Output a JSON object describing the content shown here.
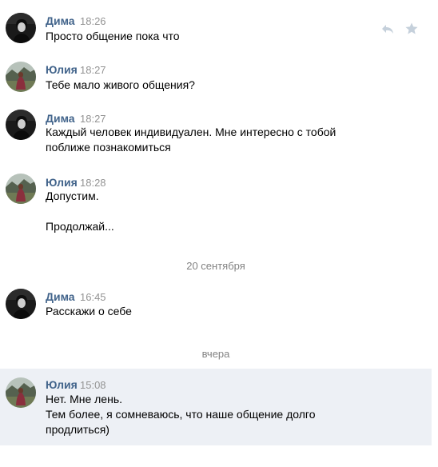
{
  "messages": [
    {
      "author": "Дима",
      "time": "18:26",
      "text": "Просто общение пока что"
    },
    {
      "author": "Юлия",
      "time": "18:27",
      "text": "Тебе мало живого общения?"
    },
    {
      "author": "Дима",
      "time": "18:27",
      "text": "Каждый человек индивидуален. Мне интересно с тобой\nпоближе познакомиться"
    },
    {
      "author": "Юлия",
      "time": "18:28",
      "text": "Допустим.\n\nПродолжай..."
    },
    {
      "author": "Дима",
      "time": "16:45",
      "text": "Расскажи о себе"
    },
    {
      "author": "Юлия",
      "time": "15:08",
      "text": "Нет. Мне лень.\nТем более, я сомневаюсь, что наше общение долго\nпродлиться)"
    }
  ],
  "separators": {
    "date_1": "20 сентября",
    "date_2": "вчера"
  },
  "icons": {
    "reply": "reply-icon",
    "favorite": "star-icon"
  },
  "colors": {
    "author": "#42648b",
    "time": "#939393",
    "highlight_background": "#edf0f5",
    "icon": "#c5d0db"
  }
}
